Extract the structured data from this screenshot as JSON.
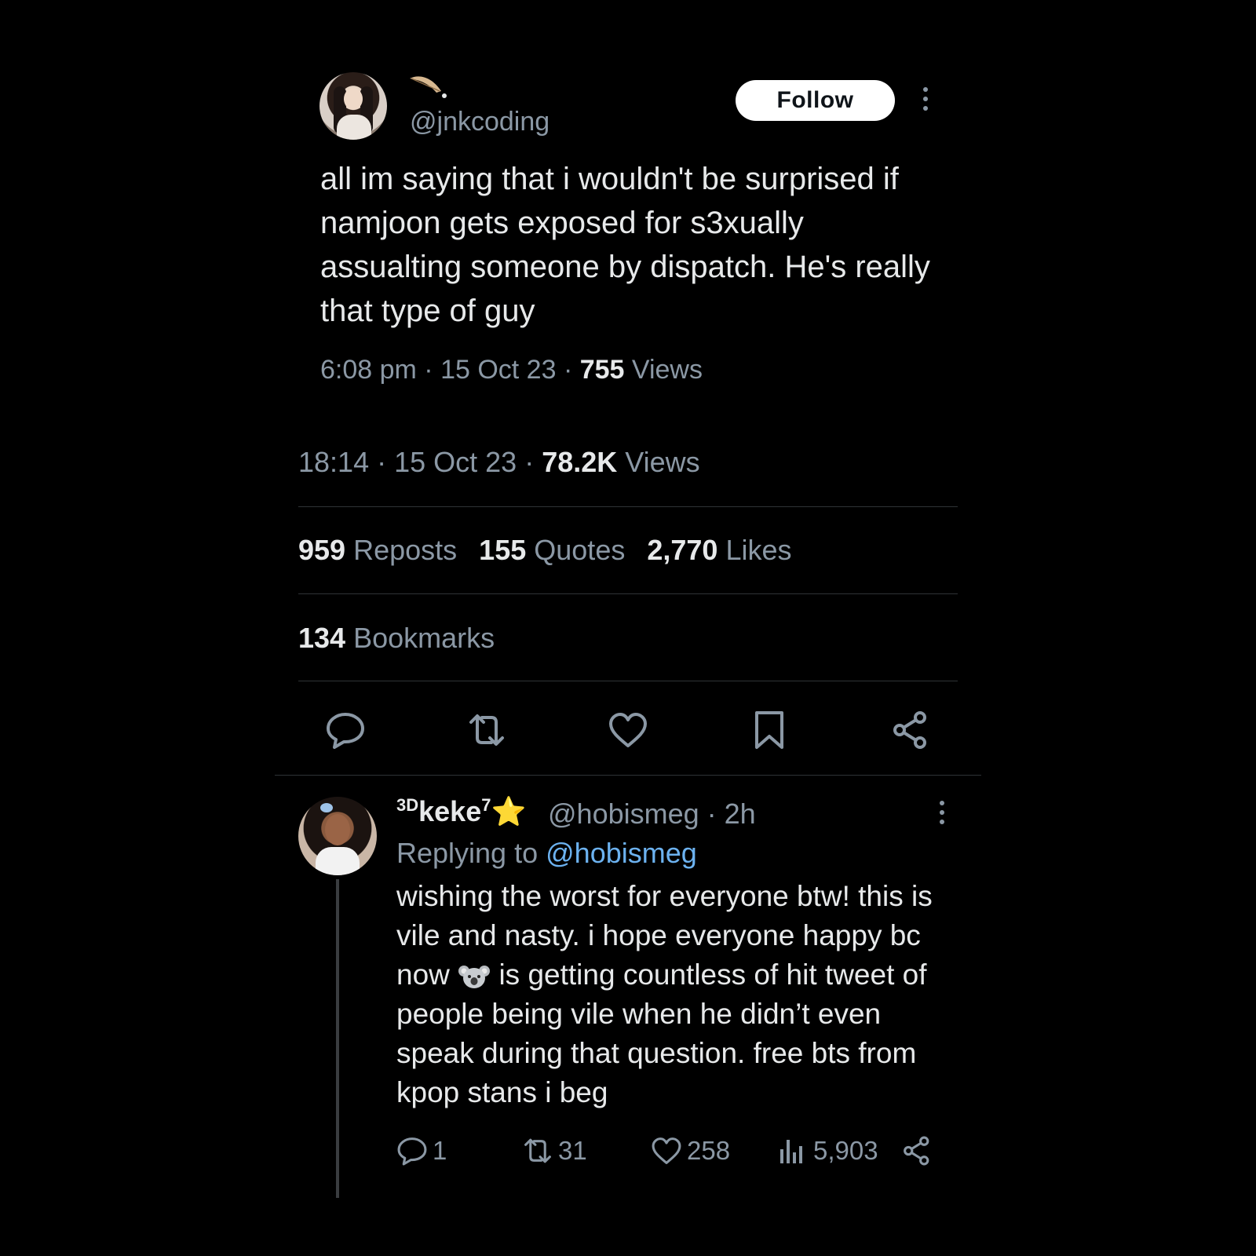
{
  "quoted_tweet": {
    "handle": "@jnkcoding",
    "follow_label": "Follow",
    "text": "all im saying that i wouldn't be surprised if namjoon gets exposed for s3xually assualting someone by dispatch. He's really that type of guy",
    "time": "6:08 pm",
    "date": "15 Oct 23",
    "views_count": "755",
    "views_label": "Views"
  },
  "main_tweet": {
    "time": "18:14",
    "date": "15 Oct 23",
    "views_count": "78.2K",
    "views_label": "Views",
    "reposts_count": "959",
    "reposts_label": "Reposts",
    "quotes_count": "155",
    "quotes_label": "Quotes",
    "likes_count": "2,770",
    "likes_label": "Likes",
    "bookmarks_count": "134",
    "bookmarks_label": "Bookmarks",
    "actions": [
      "reply-icon",
      "repost-icon",
      "like-icon",
      "bookmark-icon",
      "share-icon"
    ]
  },
  "reply": {
    "name_prefix": "3D",
    "name": "keke",
    "name_suffix": "7",
    "name_emoji": "⭐",
    "handle": "@hobismeg",
    "age": "2h",
    "replying_to_label": "Replying to",
    "replying_to_handle": "@hobismeg",
    "text_part1": "wishing the worst for everyone btw! this is vile and nasty. i hope everyone happy bc now",
    "text_emoji": "koala",
    "text_part2": "is getting countless of hit tweet of people being vile when he didn’t even speak during that question. free bts from kpop stans i beg",
    "reply_count": "1",
    "repost_count": "31",
    "like_count": "258",
    "view_count": "5,903"
  },
  "colors": {
    "background": "#000000",
    "text_primary": "#e7e9ea",
    "text_secondary": "#8b98a5",
    "link": "#6cb2f0",
    "divider": "#2f3336",
    "star": "#ffcc33"
  }
}
